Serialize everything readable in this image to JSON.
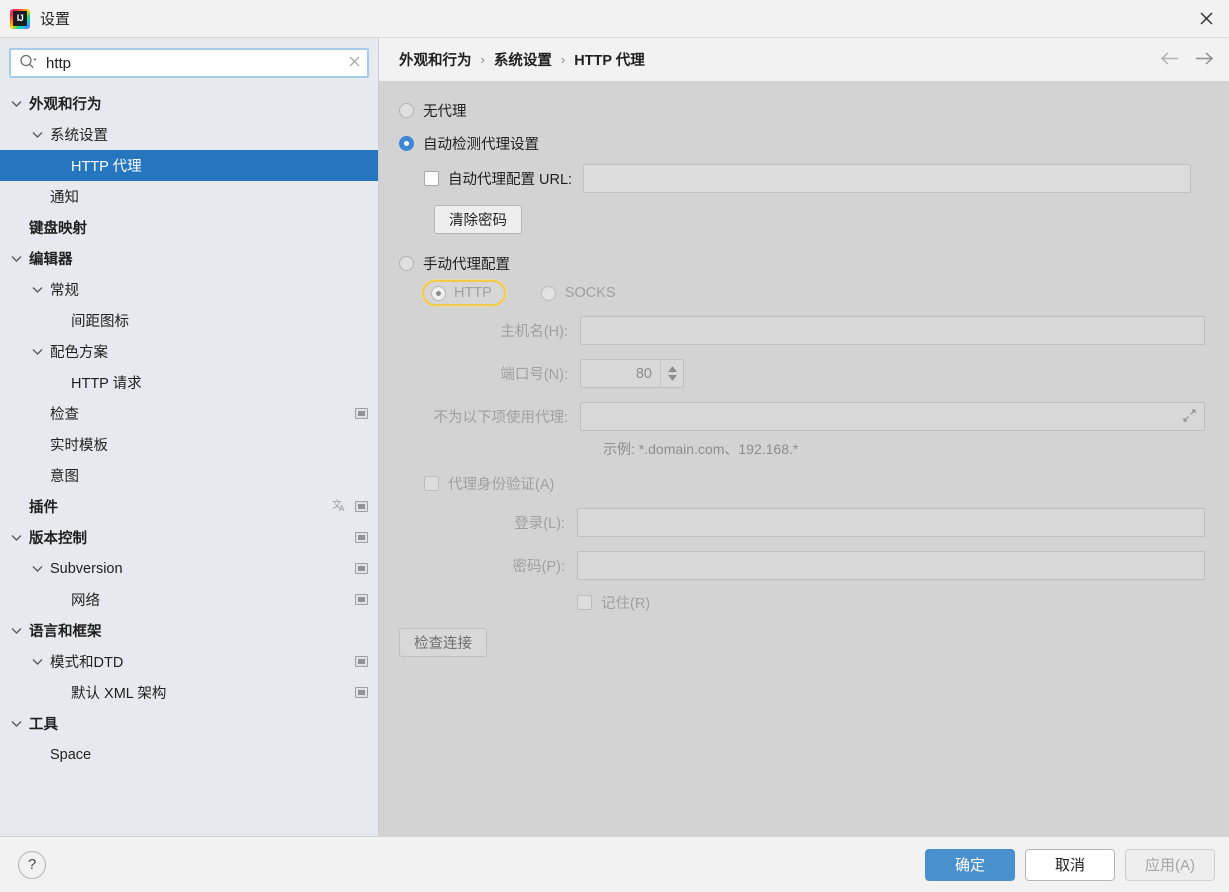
{
  "window": {
    "title": "设置",
    "logo_icon": "intellij-idea-logo",
    "close_icon": "close-icon"
  },
  "search": {
    "value": "http",
    "placeholder": "",
    "search_icon": "search-icon",
    "clear_icon": "clear-icon"
  },
  "sidebar": {
    "items": [
      {
        "label": "外观和行为",
        "indent": 0,
        "bold": true,
        "chevron": "chevron-down-icon",
        "selected": false,
        "badges": []
      },
      {
        "label": "系统设置",
        "indent": 1,
        "bold": false,
        "chevron": "chevron-down-icon",
        "selected": false,
        "badges": []
      },
      {
        "label": "HTTP 代理",
        "indent": 2,
        "bold": false,
        "chevron": "",
        "selected": true,
        "badges": []
      },
      {
        "label": "通知",
        "indent": 1,
        "bold": false,
        "chevron": "",
        "selected": false,
        "badges": []
      },
      {
        "label": "键盘映射",
        "indent": 0,
        "bold": true,
        "chevron": "",
        "selected": false,
        "badges": []
      },
      {
        "label": "编辑器",
        "indent": 0,
        "bold": true,
        "chevron": "chevron-down-icon",
        "selected": false,
        "badges": []
      },
      {
        "label": "常规",
        "indent": 1,
        "bold": false,
        "chevron": "chevron-down-icon",
        "selected": false,
        "badges": []
      },
      {
        "label": "间距图标",
        "indent": 2,
        "bold": false,
        "chevron": "",
        "selected": false,
        "badges": []
      },
      {
        "label": "配色方案",
        "indent": 1,
        "bold": false,
        "chevron": "chevron-down-icon",
        "selected": false,
        "badges": []
      },
      {
        "label": "HTTP 请求",
        "indent": 2,
        "bold": false,
        "chevron": "",
        "selected": false,
        "badges": []
      },
      {
        "label": "检查",
        "indent": 1,
        "bold": false,
        "chevron": "",
        "selected": false,
        "badges": [
          "project-badge-icon"
        ]
      },
      {
        "label": "实时模板",
        "indent": 1,
        "bold": false,
        "chevron": "",
        "selected": false,
        "badges": []
      },
      {
        "label": "意图",
        "indent": 1,
        "bold": false,
        "chevron": "",
        "selected": false,
        "badges": []
      },
      {
        "label": "插件",
        "indent": 0,
        "bold": true,
        "chevron": "",
        "selected": false,
        "badges": [
          "translate-badge-icon",
          "project-badge-icon"
        ]
      },
      {
        "label": "版本控制",
        "indent": 0,
        "bold": true,
        "chevron": "chevron-down-icon",
        "selected": false,
        "badges": [
          "project-badge-icon"
        ]
      },
      {
        "label": "Subversion",
        "indent": 1,
        "bold": false,
        "chevron": "chevron-down-icon",
        "selected": false,
        "badges": [
          "project-badge-icon"
        ]
      },
      {
        "label": "网络",
        "indent": 2,
        "bold": false,
        "chevron": "",
        "selected": false,
        "badges": [
          "project-badge-icon"
        ]
      },
      {
        "label": "语言和框架",
        "indent": 0,
        "bold": true,
        "chevron": "chevron-down-icon",
        "selected": false,
        "badges": []
      },
      {
        "label": "模式和DTD",
        "indent": 1,
        "bold": false,
        "chevron": "chevron-down-icon",
        "selected": false,
        "badges": [
          "project-badge-icon"
        ]
      },
      {
        "label": "默认 XML 架构",
        "indent": 2,
        "bold": false,
        "chevron": "",
        "selected": false,
        "badges": [
          "project-badge-icon"
        ]
      },
      {
        "label": "工具",
        "indent": 0,
        "bold": true,
        "chevron": "chevron-down-icon",
        "selected": false,
        "badges": []
      },
      {
        "label": "Space",
        "indent": 1,
        "bold": false,
        "chevron": "",
        "selected": false,
        "badges": []
      }
    ]
  },
  "breadcrumb": {
    "items": [
      "外观和行为",
      "系统设置",
      "HTTP 代理"
    ],
    "separator": "›",
    "back_icon": "arrow-left-icon",
    "forward_icon": "arrow-right-icon"
  },
  "proxy": {
    "no_proxy_label": "无代理",
    "auto_detect_label": "自动检测代理设置",
    "auto_config_url_label": "自动代理配置 URL:",
    "auto_config_url_value": "",
    "clear_password_label": "清除密码",
    "manual_label": "手动代理配置",
    "http_label": "HTTP",
    "socks_label": "SOCKS",
    "host_label": "主机名(H):",
    "host_value": "",
    "port_label": "端口号(N):",
    "port_value": "80",
    "no_proxy_for_label": "不为以下项使用代理:",
    "no_proxy_for_value": "",
    "expand_icon": "expand-icon",
    "example_hint": "示例: *.domain.com、192.168.*",
    "auth_label": "代理身份验证(A)",
    "login_label": "登录(L):",
    "login_value": "",
    "password_label": "密码(P):",
    "password_value": "",
    "remember_label": "记住(R)",
    "check_connection_label": "检查连接",
    "selected_mode": "auto_detect",
    "selected_protocol": "HTTP"
  },
  "footer": {
    "help_label": "?",
    "help_icon": "help-icon",
    "ok_label": "确定",
    "cancel_label": "取消",
    "apply_label": "应用(A)"
  },
  "colors": {
    "selection": "#2675bf",
    "primary_button": "#4a90cf",
    "sidebar_bg": "#e6eaee",
    "panel_bg": "#d3d3d3",
    "focus_ring": "#f2c94c"
  }
}
